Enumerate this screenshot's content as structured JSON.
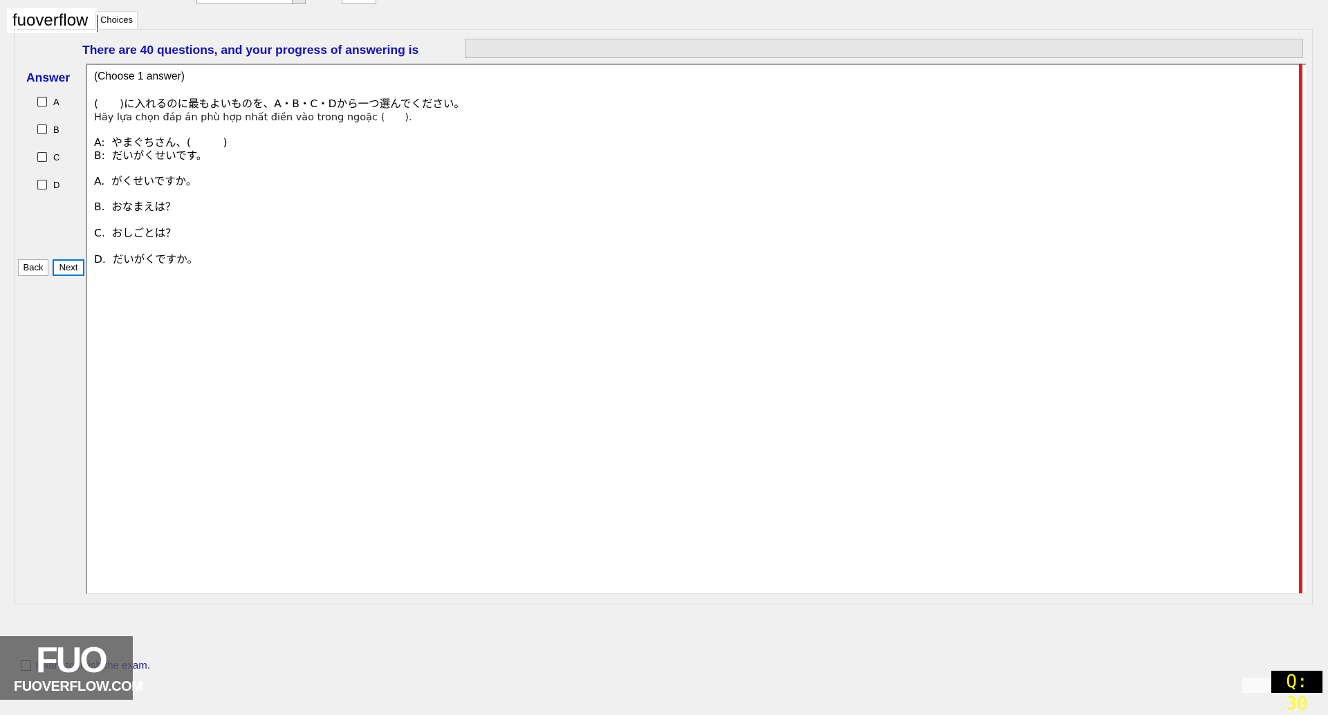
{
  "watermark_label": "fuoverflow",
  "tab": {
    "label": "Choices"
  },
  "progress": {
    "caption": "There are 40 questions, and your progress of answering is",
    "value": 0
  },
  "answer_panel": {
    "heading": "Answer",
    "options": [
      {
        "label": "A",
        "checked": false
      },
      {
        "label": "B",
        "checked": false
      },
      {
        "label": "C",
        "checked": false
      },
      {
        "label": "D",
        "checked": false
      }
    ],
    "back_label": "Back",
    "next_label": "Next"
  },
  "question": {
    "hint": "(Choose 1 answer)",
    "instruction_jp": "(　　)に入れるのに最もよいものを、A・B・C・Dから一つ選んでください。",
    "instruction_vi": "Hãy lựa chọn đáp án phù hợp nhất điền vào trong ngoặc (　　).",
    "dialog_a": "A:  やまぐちさん、(　　　)",
    "dialog_b": "B:  だいがくせいです。",
    "choices": [
      "A.  がくせいですか。",
      "B.  おなまえは？",
      "C.  おしごとは？",
      "D.  だいがくですか。"
    ]
  },
  "finish": {
    "label": "I want to finish the exam.",
    "checked": false
  },
  "logo": {
    "big": "FUO",
    "small": "FUOVERFLOW.COM"
  },
  "counter": "Q: 30",
  "colors": {
    "accent": "#1010b8",
    "marker": "#e81818",
    "counter_fg": "#ffff00",
    "counter_bg": "#000000"
  }
}
